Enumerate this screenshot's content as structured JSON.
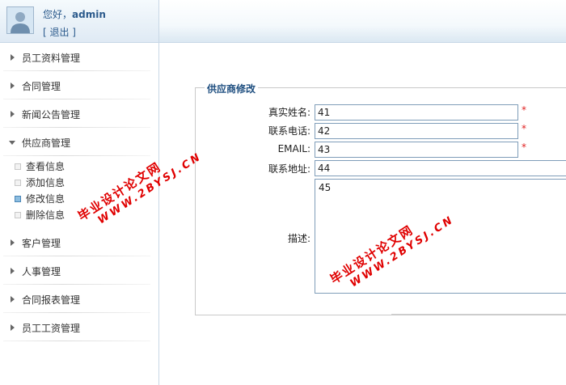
{
  "user": {
    "greeting": "您好，",
    "name": "admin",
    "logout": "[ 退出 ]"
  },
  "menu": {
    "items": [
      {
        "label": "员工资料管理"
      },
      {
        "label": "合同管理"
      },
      {
        "label": "新闻公告管理"
      },
      {
        "label": "供应商管理"
      },
      {
        "label": "客户管理"
      },
      {
        "label": "人事管理"
      },
      {
        "label": "合同报表管理"
      },
      {
        "label": "员工工资管理"
      }
    ],
    "submenu": [
      {
        "label": "查看信息"
      },
      {
        "label": "添加信息"
      },
      {
        "label": "修改信息"
      },
      {
        "label": "删除信息"
      }
    ]
  },
  "form": {
    "legend": "供应商修改",
    "fields": [
      {
        "label": "真实姓名:",
        "value": "41",
        "required": "*"
      },
      {
        "label": "联系电话:",
        "value": "42",
        "required": "*"
      },
      {
        "label": "EMAIL:",
        "value": "43",
        "required": "*"
      },
      {
        "label": "联系地址:",
        "value": "44"
      }
    ],
    "desc_label": "描述:",
    "desc_value": "45"
  },
  "watermark": {
    "line1": "毕业设计论文网",
    "line2": "WWW.2BYSJ.CN"
  },
  "colors": {
    "link": "#2b5a8c",
    "legend": "#1f4f80",
    "required": "#e02020",
    "input_border": "#7f9db9",
    "watermark": "#e00000"
  }
}
